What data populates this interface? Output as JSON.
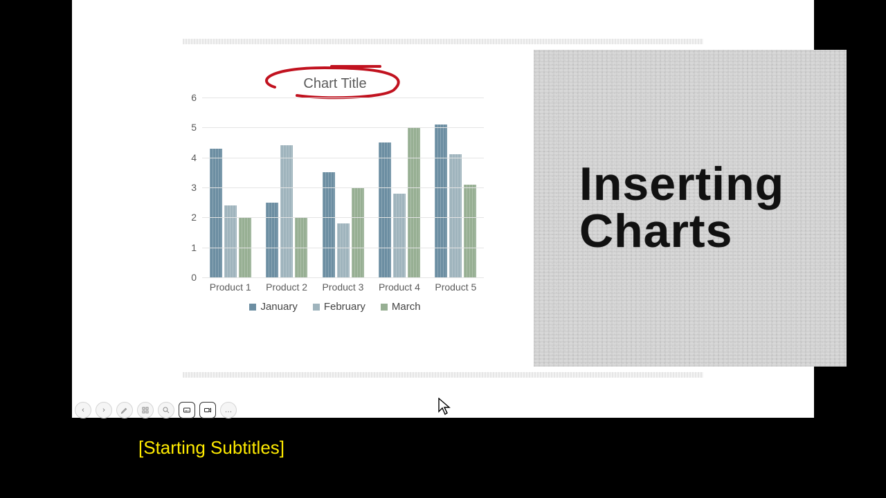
{
  "slide": {
    "right_title_line1": "Inserting",
    "right_title_line2": "Charts"
  },
  "chart_data": {
    "type": "bar",
    "title": "Chart Title",
    "xlabel": "",
    "ylabel": "",
    "ylim": [
      0,
      6
    ],
    "yticks": [
      0,
      1,
      2,
      3,
      4,
      5,
      6
    ],
    "categories": [
      "Product 1",
      "Product 2",
      "Product 3",
      "Product 4",
      "Product 5"
    ],
    "series": [
      {
        "name": "January",
        "values": [
          4.3,
          2.5,
          3.5,
          4.5,
          5.1
        ],
        "color": "#6c8ea2"
      },
      {
        "name": "February",
        "values": [
          2.4,
          4.4,
          1.8,
          2.8,
          4.1
        ],
        "color": "#9fb4bd"
      },
      {
        "name": "March",
        "values": [
          2.0,
          2.0,
          3.0,
          5.0,
          3.1
        ],
        "color": "#97af93"
      }
    ],
    "legend_position": "bottom",
    "annotations": {
      "title_circled_in_red": true,
      "legend_highlight_series": "March"
    }
  },
  "toolbar": {
    "prev": "‹",
    "next": "›",
    "pen": "pen",
    "see_all": "grid",
    "zoom": "zoom",
    "subtitles": "cc",
    "camera": "camera",
    "more": "…"
  },
  "subtitles": {
    "text": "[Starting Subtitles]"
  }
}
